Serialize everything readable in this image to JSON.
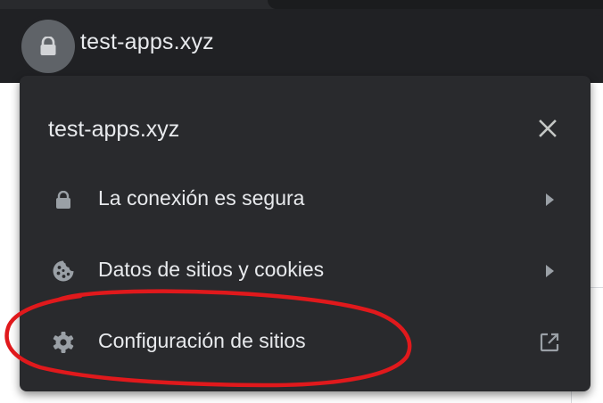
{
  "address_bar": {
    "url": "test-apps.xyz",
    "lock_icon": "lock-icon"
  },
  "popup": {
    "title": "test-apps.xyz",
    "close_icon": "close-icon",
    "items": [
      {
        "icon": "lock-icon",
        "label": "La conexión es segura",
        "trailing_icon": "chevron-right-icon"
      },
      {
        "icon": "cookie-icon",
        "label": "Datos de sitios y cookies",
        "trailing_icon": "chevron-right-icon"
      },
      {
        "icon": "gear-icon",
        "label": "Configuración de sitios",
        "trailing_icon": "external-link-icon"
      }
    ]
  },
  "colors": {
    "popup_background": "#292a2d",
    "text": "#e8eaed",
    "icon": "#9aa0a6",
    "annotation": "#e0191c"
  }
}
